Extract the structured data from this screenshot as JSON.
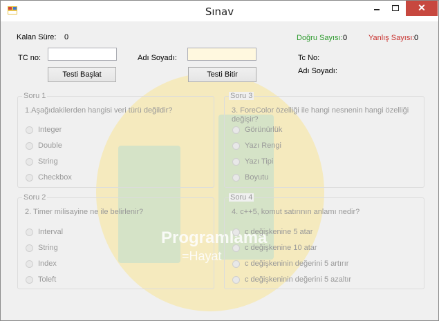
{
  "window": {
    "title": "Sınav",
    "close_glyph": "✕"
  },
  "header": {
    "kalan_sure_label": "Kalan Süre:",
    "kalan_sure_value": "0",
    "dogru_label": "Doğru Sayısı:",
    "dogru_value": "0",
    "yanlis_label": "Yanlış Sayısı:",
    "yanlis_value": "0",
    "tc_label": "TC no:",
    "tc_value": "",
    "ad_label": "Adı Soyadı:",
    "ad_value": "",
    "start_button": "Testi Başlat",
    "finish_button": "Testi Bitir",
    "info_tc_label": "Tc No:",
    "info_ad_label": "Adı Soyadı:"
  },
  "watermark": {
    "line1": "Programlama",
    "line2": "=Hayat"
  },
  "questions": [
    {
      "title": "Soru 1",
      "text": "1.Aşağıdakilerden hangisi veri türü değildir?",
      "options": [
        "Integer",
        "Double",
        "String",
        "Checkbox"
      ]
    },
    {
      "title": "Soru 3",
      "text": "3. ForeColor özelliği ile hangi nesnenin hangi özelliği\ndeğişir?",
      "options": [
        "Görünürlük",
        "Yazı Rengi",
        "Yazı Tipi",
        "Boyutu"
      ]
    },
    {
      "title": "Soru 2",
      "text": "2. Timer milisayine ne ile belirlenir?",
      "options": [
        "Interval",
        "String",
        "Index",
        "Toleft"
      ]
    },
    {
      "title": "Soru 4",
      "text": "4. c++5, komut satırının anlamı nedir?",
      "options": [
        "c değişkenine 5 atar",
        "c değişkenine 10 atar",
        "c değişkeninin değerini 5 artırır",
        "c değişkeninin değerini 5 azaltır"
      ]
    }
  ],
  "colors": {
    "correct": "#2e9b2e",
    "wrong": "#c8322f",
    "close_button": "#c7483f"
  }
}
